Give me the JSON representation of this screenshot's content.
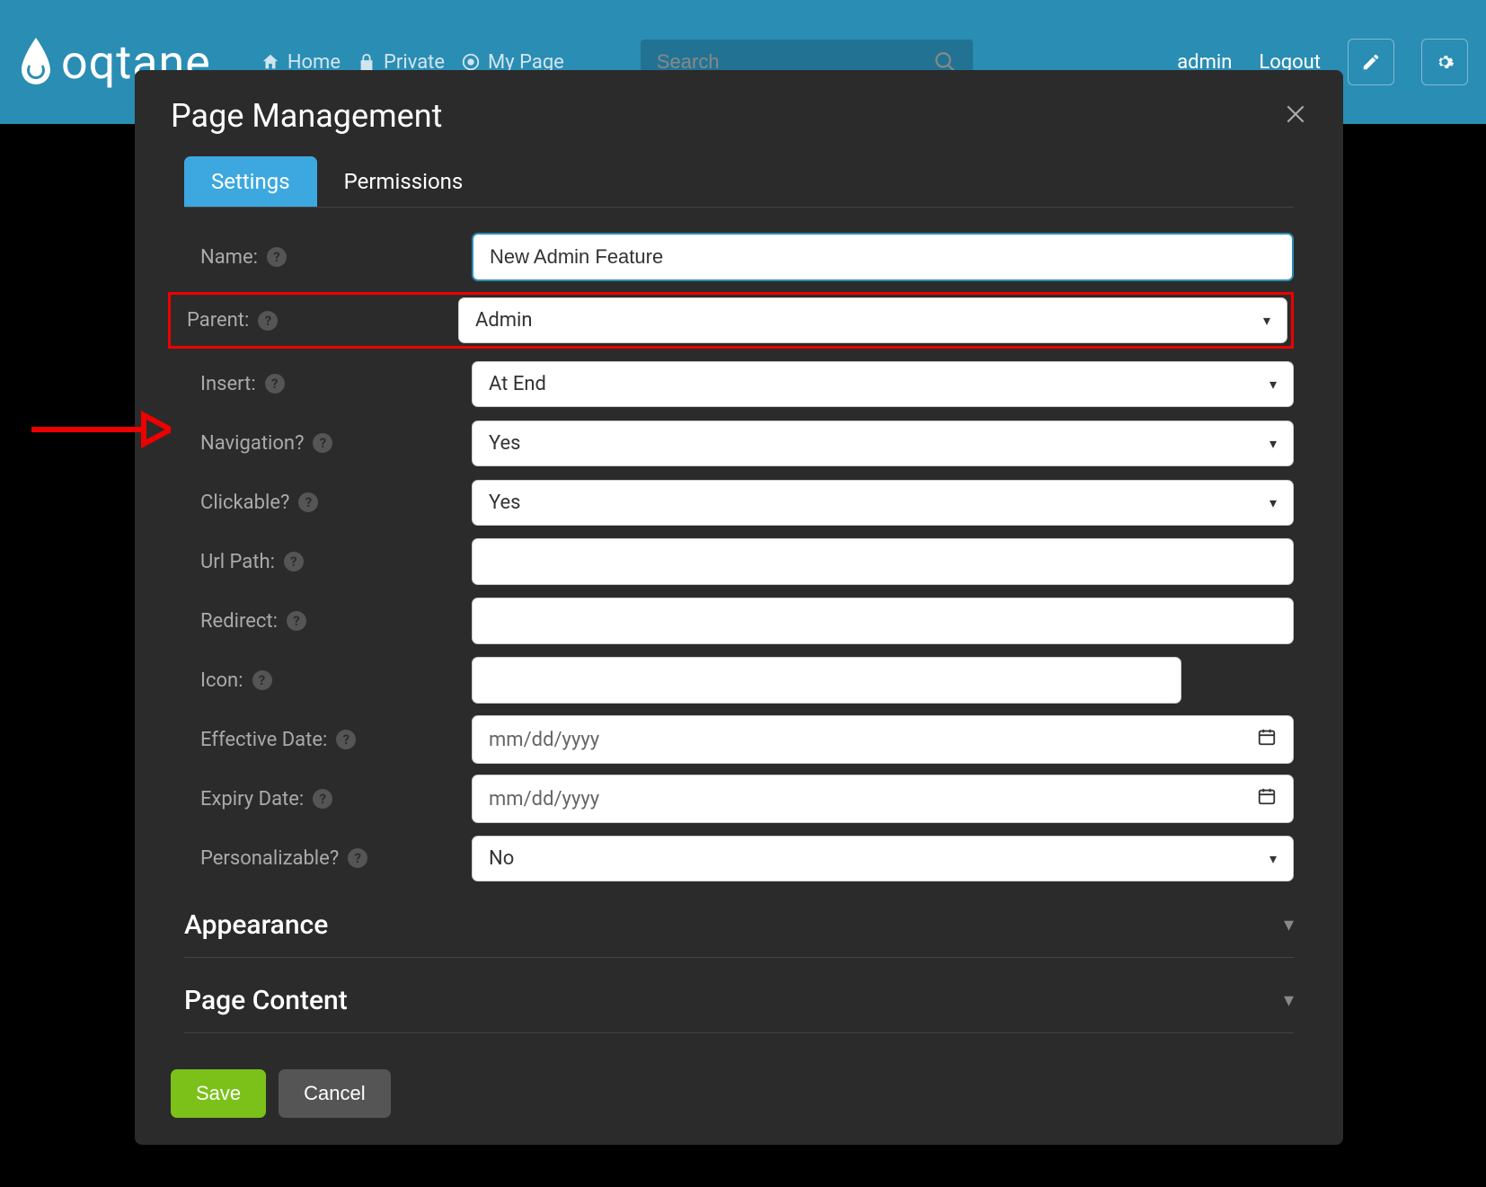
{
  "topbar": {
    "logo_text": "oqtane",
    "nav": {
      "home": "Home",
      "private": "Private",
      "mypage": "My Page"
    },
    "search_placeholder": "Search",
    "admin": "admin",
    "logout": "Logout"
  },
  "modal": {
    "title": "Page Management",
    "tabs": {
      "settings": "Settings",
      "permissions": "Permissions"
    },
    "labels": {
      "name": "Name:",
      "parent": "Parent:",
      "insert": "Insert:",
      "navigation": "Navigation?",
      "clickable": "Clickable?",
      "urlpath": "Url Path:",
      "redirect": "Redirect:",
      "icon": "Icon:",
      "effective": "Effective Date:",
      "expiry": "Expiry Date:",
      "personalizable": "Personalizable?"
    },
    "values": {
      "name": "New Admin Feature",
      "parent": "Admin",
      "insert": "At End",
      "navigation": "Yes",
      "clickable": "Yes",
      "urlpath": "",
      "redirect": "",
      "icon": "",
      "effective": "mm/dd/yyyy",
      "expiry": "mm/dd/yyyy",
      "personalizable": "No"
    },
    "sections": {
      "appearance": "Appearance",
      "pagecontent": "Page Content"
    },
    "buttons": {
      "save": "Save",
      "cancel": "Cancel"
    }
  }
}
